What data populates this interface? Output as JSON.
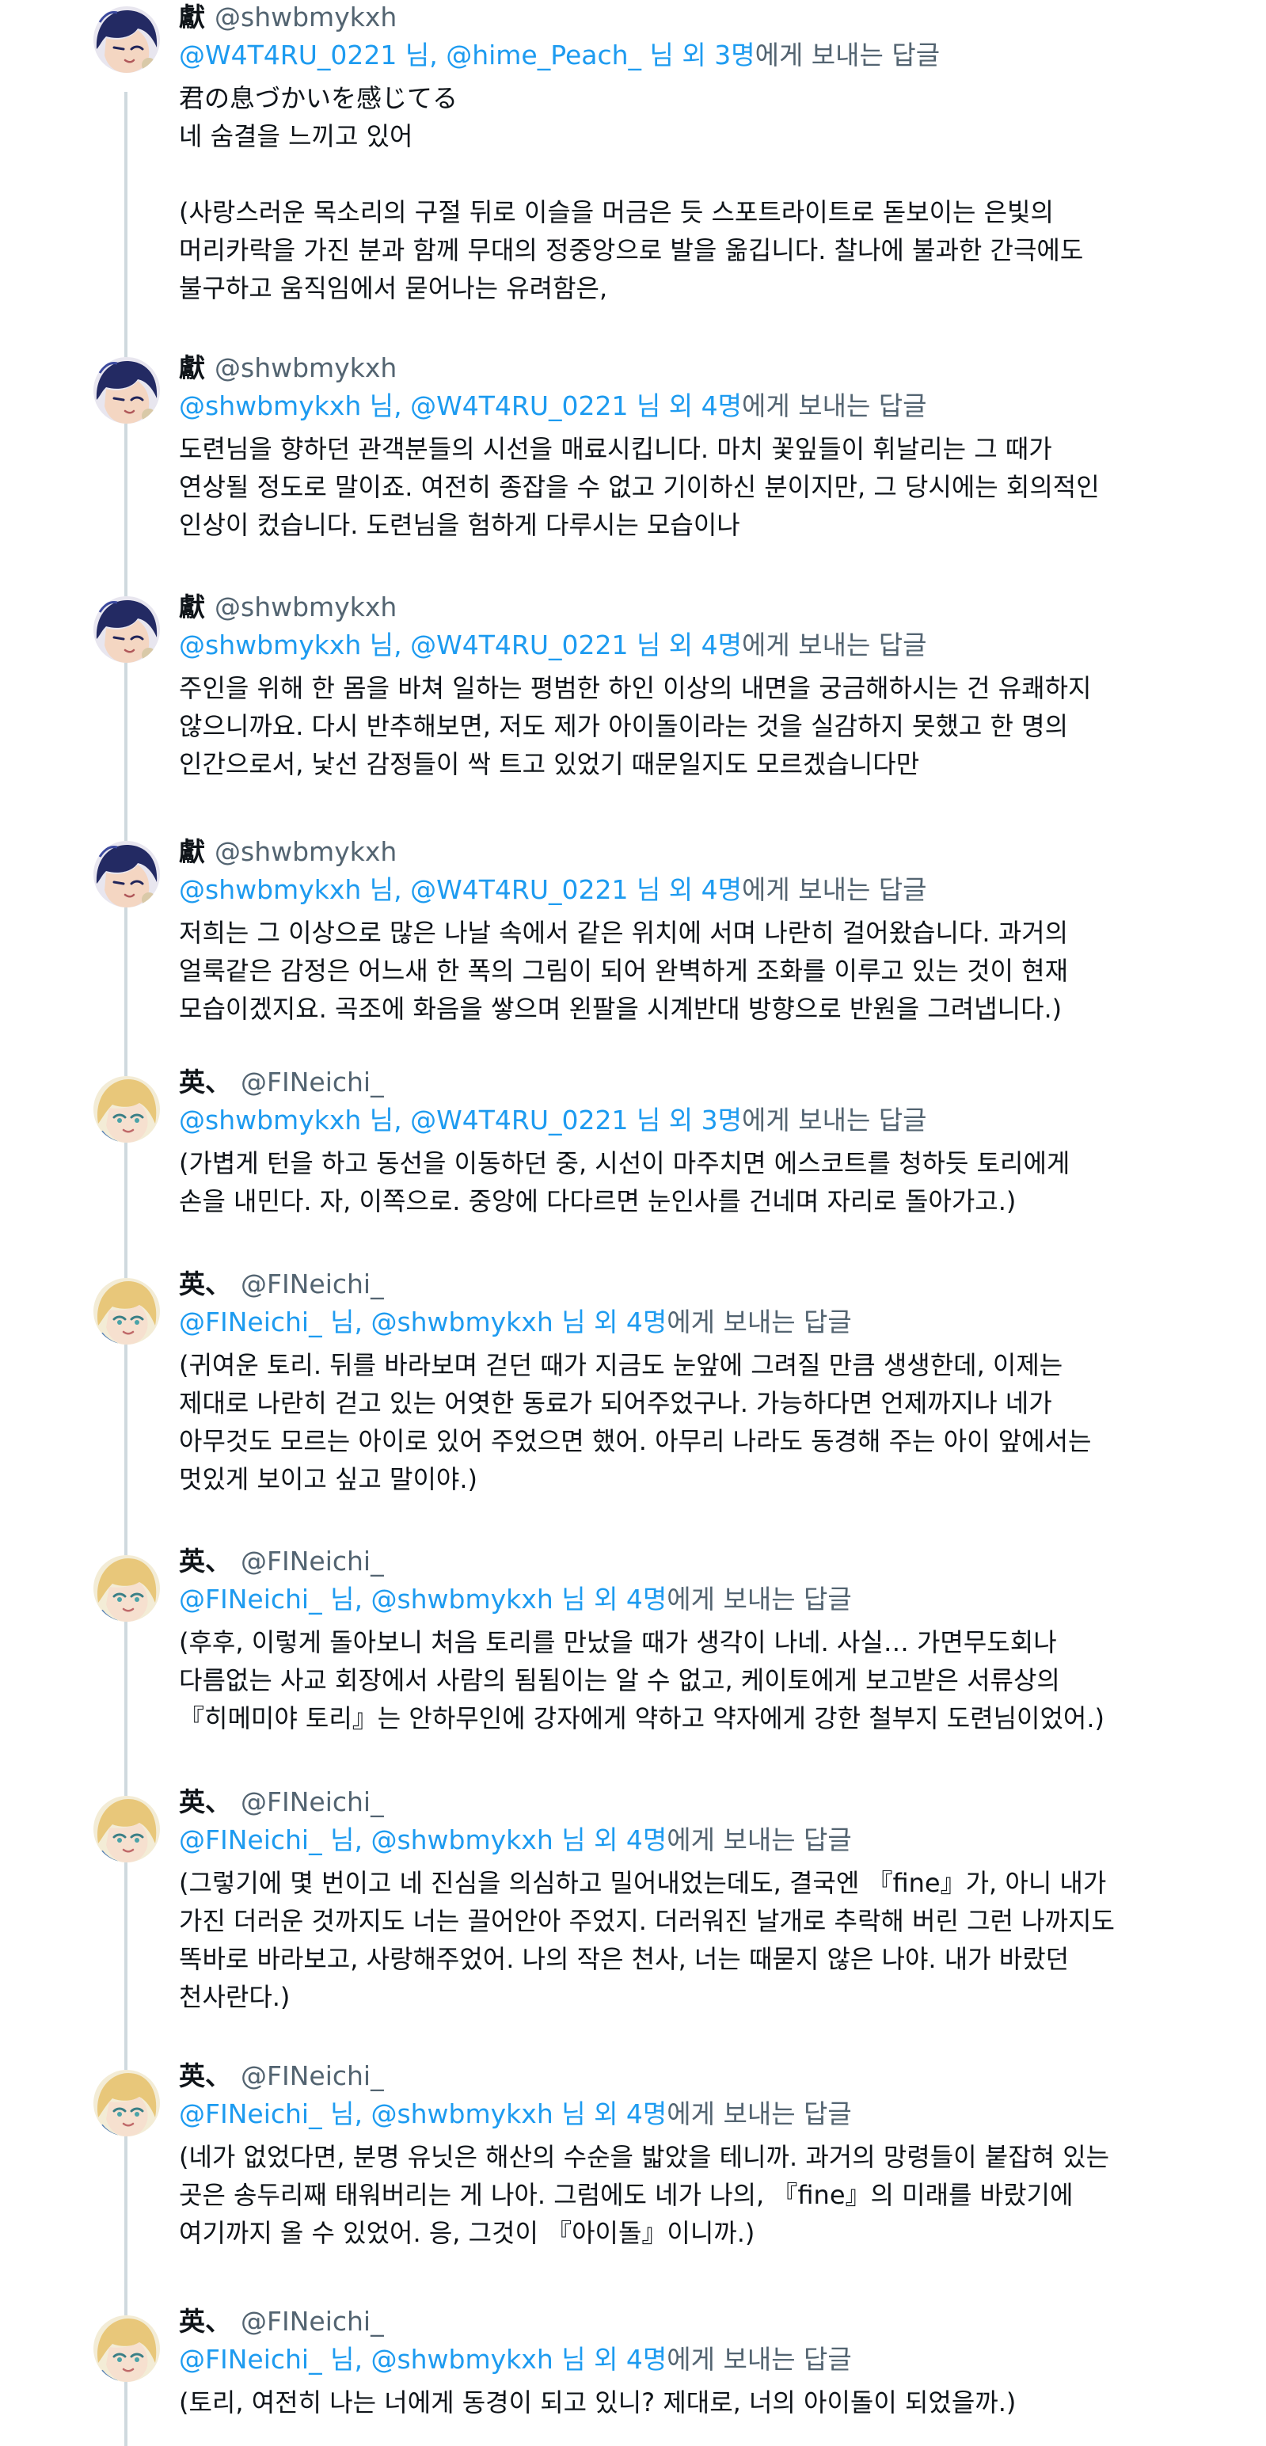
{
  "accent_color": "#1d9bf0",
  "muted_color": "#536471",
  "reply_suffix": "에게 보내는 답글",
  "tweets": [
    {
      "avatar": "dark-haired-character-avatar",
      "name": "獻",
      "handle": "@shwbmykxh",
      "reply": {
        "u1": "@W4T4RU_0221",
        "sep1": " 님, ",
        "u2": "@hime_Peach_",
        "sep2": " 님 외 3명",
        "suffix": "에게 보내는 답글"
      },
      "lines": [
        "君の息づかいを感じてる",
        "네 숨결을 느끼고 있어",
        "",
        "(사랑스러운 목소리의 구절 뒤로 이슬을 머금은 듯 스포트라이트로 돋보이는 은빛의",
        "머리카락을 가진 분과 함께 무대의 정중앙으로 발을 옮깁니다. 찰나에 불과한 간극에도",
        "불구하고 움직임에서 묻어나는 유려함은,"
      ]
    },
    {
      "avatar": "dark-haired-character-avatar",
      "name": "獻",
      "handle": "@shwbmykxh",
      "reply": {
        "u1": "@shwbmykxh",
        "sep1": " 님, ",
        "u2": "@W4T4RU_0221",
        "sep2": " 님 외 4명",
        "suffix": "에게 보내는 답글"
      },
      "lines": [
        "도련님을 향하던 관객분들의 시선을 매료시킵니다. 마치 꽃잎들이 휘날리는 그 때가",
        "연상될 정도로 말이죠. 여전히 종잡을 수 없고 기이하신 분이지만, 그 당시에는 회의적인",
        "인상이 컸습니다. 도련님을 험하게 다루시는 모습이나"
      ]
    },
    {
      "avatar": "dark-haired-character-avatar",
      "name": "獻",
      "handle": "@shwbmykxh",
      "reply": {
        "u1": "@shwbmykxh",
        "sep1": " 님, ",
        "u2": "@W4T4RU_0221",
        "sep2": " 님 외 4명",
        "suffix": "에게 보내는 답글"
      },
      "lines": [
        "주인을 위해 한 몸을 바쳐 일하는 평범한 하인 이상의 내면을 궁금해하시는 건 유쾌하지",
        "않으니까요. 다시 반추해보면, 저도 제가 아이돌이라는 것을 실감하지 못했고 한 명의",
        "인간으로서, 낯선 감정들이 싹 트고 있었기 때문일지도 모르겠습니다만"
      ]
    },
    {
      "avatar": "dark-haired-character-avatar",
      "name": "獻",
      "handle": "@shwbmykxh",
      "reply": {
        "u1": "@shwbmykxh",
        "sep1": " 님, ",
        "u2": "@W4T4RU_0221",
        "sep2": " 님 외 4명",
        "suffix": "에게 보내는 답글"
      },
      "lines": [
        "저희는 그 이상으로 많은 나날 속에서 같은 위치에 서며 나란히 걸어왔습니다. 과거의",
        "얼룩같은 감정은 어느새 한 폭의 그림이 되어 완벽하게 조화를 이루고 있는 것이 현재",
        "모습이겠지요. 곡조에 화음을 쌓으며 왼팔을 시계반대 방향으로 반원을 그려냅니다.)"
      ]
    },
    {
      "avatar": "blonde-character-avatar",
      "name": "英、",
      "handle": "@FINeichi_",
      "reply": {
        "u1": "@shwbmykxh",
        "sep1": " 님, ",
        "u2": "@W4T4RU_0221",
        "sep2": " 님 외 3명",
        "suffix": "에게 보내는 답글"
      },
      "lines": [
        "(가볍게 턴을 하고 동선을 이동하던 중, 시선이 마주치면 에스코트를 청하듯 토리에게",
        "손을 내민다. 자, 이쪽으로. 중앙에 다다르면 눈인사를 건네며 자리로 돌아가고.)"
      ]
    },
    {
      "avatar": "blonde-character-avatar",
      "name": "英、",
      "handle": "@FINeichi_",
      "reply": {
        "u1": "@FINeichi_",
        "sep1": " 님, ",
        "u2": "@shwbmykxh",
        "sep2": " 님 외 4명",
        "suffix": "에게 보내는 답글"
      },
      "lines": [
        "(귀여운 토리. 뒤를 바라보며 걷던 때가 지금도 눈앞에 그려질 만큼 생생한데, 이제는",
        "제대로 나란히 걷고 있는 어엿한 동료가 되어주었구나. 가능하다면 언제까지나 네가",
        "아무것도 모르는 아이로 있어 주었으면 했어. 아무리 나라도 동경해 주는 아이 앞에서는",
        "멋있게 보이고 싶고 말이야.)"
      ]
    },
    {
      "avatar": "blonde-character-avatar",
      "name": "英、",
      "handle": "@FINeichi_",
      "reply": {
        "u1": "@FINeichi_",
        "sep1": " 님, ",
        "u2": "@shwbmykxh",
        "sep2": " 님 외 4명",
        "suffix": "에게 보내는 답글"
      },
      "lines": [
        "(후후, 이렇게 돌아보니 처음 토리를 만났을 때가 생각이 나네. 사실… 가면무도회나",
        "다름없는 사교 회장에서 사람의 됨됨이는 알 수 없고, 케이토에게 보고받은 서류상의",
        "『히메미야 토리』는 안하무인에 강자에게 약하고 약자에게 강한 철부지 도련님이었어.)"
      ]
    },
    {
      "avatar": "blonde-character-avatar",
      "name": "英、",
      "handle": "@FINeichi_",
      "reply": {
        "u1": "@FINeichi_",
        "sep1": " 님, ",
        "u2": "@shwbmykxh",
        "sep2": " 님 외 4명",
        "suffix": "에게 보내는 답글"
      },
      "lines": [
        "(그렇기에 몇 번이고 네 진심을 의심하고 밀어내었는데도, 결국엔 『fine』가, 아니 내가",
        "가진 더러운 것까지도 너는 끌어안아 주었지. 더러워진 날개로 추락해 버린 그런 나까지도",
        "똑바로 바라보고, 사랑해주었어. 나의 작은 천사, 너는 때묻지 않은 나야. 내가 바랐던",
        "천사란다.)"
      ]
    },
    {
      "avatar": "blonde-character-avatar",
      "name": "英、",
      "handle": "@FINeichi_",
      "reply": {
        "u1": "@FINeichi_",
        "sep1": " 님, ",
        "u2": "@shwbmykxh",
        "sep2": " 님 외 4명",
        "suffix": "에게 보내는 답글"
      },
      "lines": [
        "(네가 없었다면, 분명 유닛은 해산의 수순을 밟았을 테니까. 과거의 망령들이 붙잡혀 있는",
        "곳은 송두리째 태워버리는 게 나아. 그럼에도 네가 나의, 『fine』의 미래를 바랐기에",
        "여기까지 올 수 있었어. 응, 그것이 『아이돌』이니까.)"
      ]
    },
    {
      "avatar": "blonde-character-avatar",
      "name": "英、",
      "handle": "@FINeichi_",
      "reply": {
        "u1": "@FINeichi_",
        "sep1": " 님, ",
        "u2": "@shwbmykxh",
        "sep2": " 님 외 4명",
        "suffix": "에게 보내는 답글"
      },
      "lines": [
        "(토리, 여전히 나는 너에게 동경이 되고 있니? 제대로, 너의 아이돌이 되었을까.)"
      ]
    }
  ]
}
